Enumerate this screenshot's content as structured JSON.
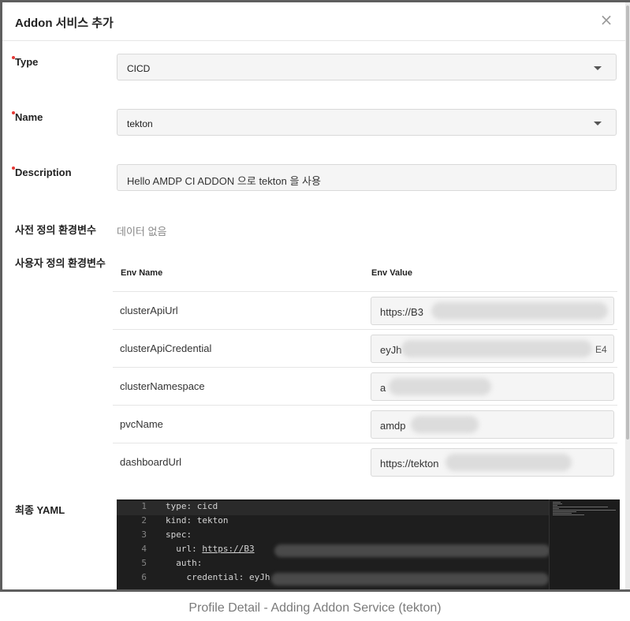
{
  "modal": {
    "title": "Addon 서비스 추가",
    "close_glyph": "×"
  },
  "form": {
    "type_label": "Type",
    "type_value": "CICD",
    "name_label": "Name",
    "name_value": "tekton",
    "description_label": "Description",
    "description_value": "Hello AMDP CI ADDON 으로 tekton 을 사용",
    "predefined_env_label": "사전 정의 환경변수",
    "predefined_env_empty": "데이터 없음",
    "user_env_label": "사용자 정의 환경변수",
    "final_yaml_label": "최종 YAML"
  },
  "env_table": {
    "headers": {
      "name": "Env Name",
      "value": "Env Value"
    },
    "rows": [
      {
        "name": "clusterApiUrl",
        "value": "https://B3",
        "suffix": ""
      },
      {
        "name": "clusterApiCredential",
        "value": "eyJh",
        "suffix": "E4"
      },
      {
        "name": "clusterNamespace",
        "value": "a",
        "suffix": ""
      },
      {
        "name": "pvcName",
        "value": "amdp",
        "suffix": ""
      },
      {
        "name": "dashboardUrl",
        "value": "https://tekton",
        "suffix": ""
      }
    ]
  },
  "yaml_editor": {
    "lines": [
      {
        "num": "1",
        "text": "type: cicd"
      },
      {
        "num": "2",
        "text": "kind: tekton"
      },
      {
        "num": "3",
        "text": "spec:"
      },
      {
        "num": "4",
        "text": "  url: ",
        "link": "https://B3"
      },
      {
        "num": "5",
        "text": "  auth:"
      },
      {
        "num": "6",
        "text": "    credential: eyJh"
      }
    ]
  },
  "caption": "Profile Detail - Adding Addon Service (tekton)",
  "colors": {
    "required_marker": "#e53935",
    "editor_bg": "#1e1e1e",
    "backdrop": "#5e5e5e"
  }
}
